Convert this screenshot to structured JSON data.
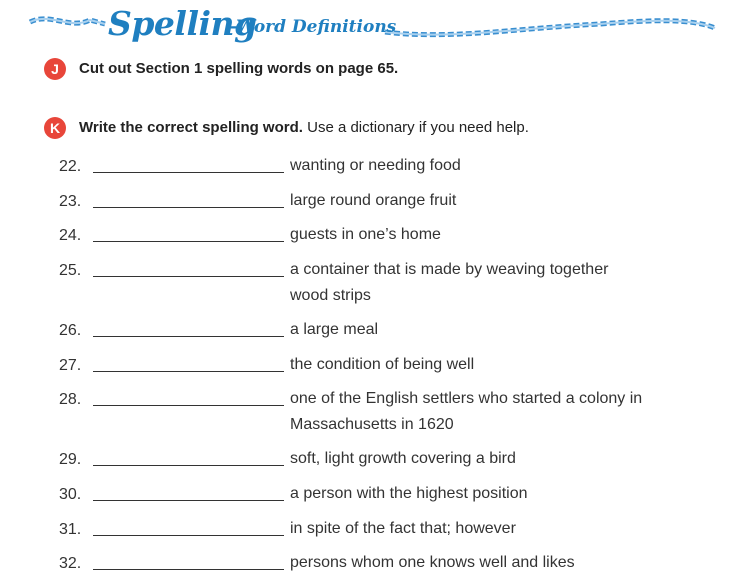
{
  "header": {
    "title": "Spelling",
    "subtitle": "-Word Definitions"
  },
  "section_j": {
    "badge": "J",
    "instruction": "Cut out Section 1 spelling words on page 65."
  },
  "section_k": {
    "badge": "K",
    "instruction_bold": "Write the correct spelling word.",
    "instruction_rest": " Use a dictionary if you need help."
  },
  "items": [
    {
      "number": "22.",
      "definition": "wanting or needing food"
    },
    {
      "number": "23.",
      "definition": "large round orange fruit"
    },
    {
      "number": "24.",
      "definition": "guests in one’s home"
    },
    {
      "number": "25.",
      "definition": "a container that is made by weaving together wood strips"
    },
    {
      "number": "26.",
      "definition": "a large meal"
    },
    {
      "number": "27.",
      "definition": "the condition of being well"
    },
    {
      "number": "28.",
      "definition": "one of the English settlers who started a colony in Massachusetts in 1620"
    },
    {
      "number": "29.",
      "definition": "soft, light growth covering a bird"
    },
    {
      "number": "30.",
      "definition": "a person with the highest position"
    },
    {
      "number": "31.",
      "definition": "in spite of the fact that; however"
    },
    {
      "number": "32.",
      "definition": "persons whom one knows well and likes"
    }
  ],
  "colors": {
    "title": "#1f7fc0",
    "badge": "#e8463a",
    "rope": "#3a8fd0"
  }
}
